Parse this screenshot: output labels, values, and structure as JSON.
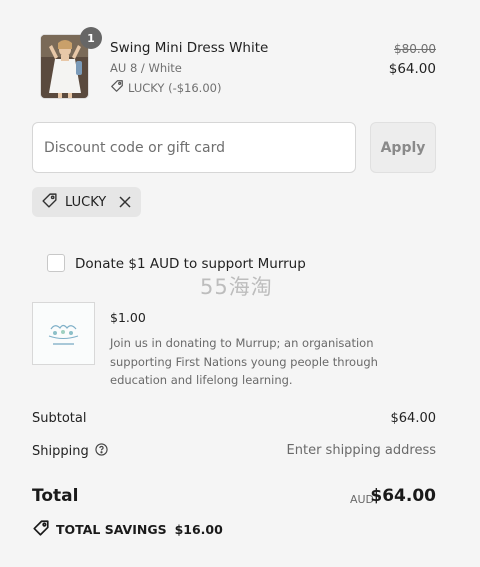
{
  "product": {
    "quantity": "1",
    "name": "Swing Mini Dress White",
    "variant": "AU 8 / White",
    "discount": "LUCKY (-$16.00)",
    "original_price": "$80.00",
    "price": "$64.00",
    "image_icon": "product-photo"
  },
  "discount_form": {
    "placeholder": "Discount code or gift card",
    "value": "",
    "apply_label": "Apply"
  },
  "applied_code": {
    "code": "LUCKY",
    "tag_icon": "tag-icon",
    "remove_icon": "close-icon"
  },
  "donation": {
    "checkbox_label": "Donate $1 AUD to support Murrup",
    "checked": false,
    "price": "$1.00",
    "description": "Join us in donating to Murrup; an organisation supporting First Nations young people through education and lifelong learning.",
    "image_icon": "murrup-logo"
  },
  "watermark": "55海淘",
  "summary": {
    "subtotal_label": "Subtotal",
    "subtotal_value": "$64.00",
    "shipping_label": "Shipping",
    "shipping_value": "Enter shipping address",
    "help_icon": "question-circle-icon",
    "total_label": "Total",
    "currency": "AUD",
    "total_value": "$64.00",
    "savings_label": "TOTAL SAVINGS",
    "savings_value": "$16.00",
    "savings_icon": "tag-icon"
  },
  "colors": {
    "background": "#f5f5f5",
    "badge": "#666666",
    "text": "#1f1f1f",
    "muted": "#707070"
  }
}
